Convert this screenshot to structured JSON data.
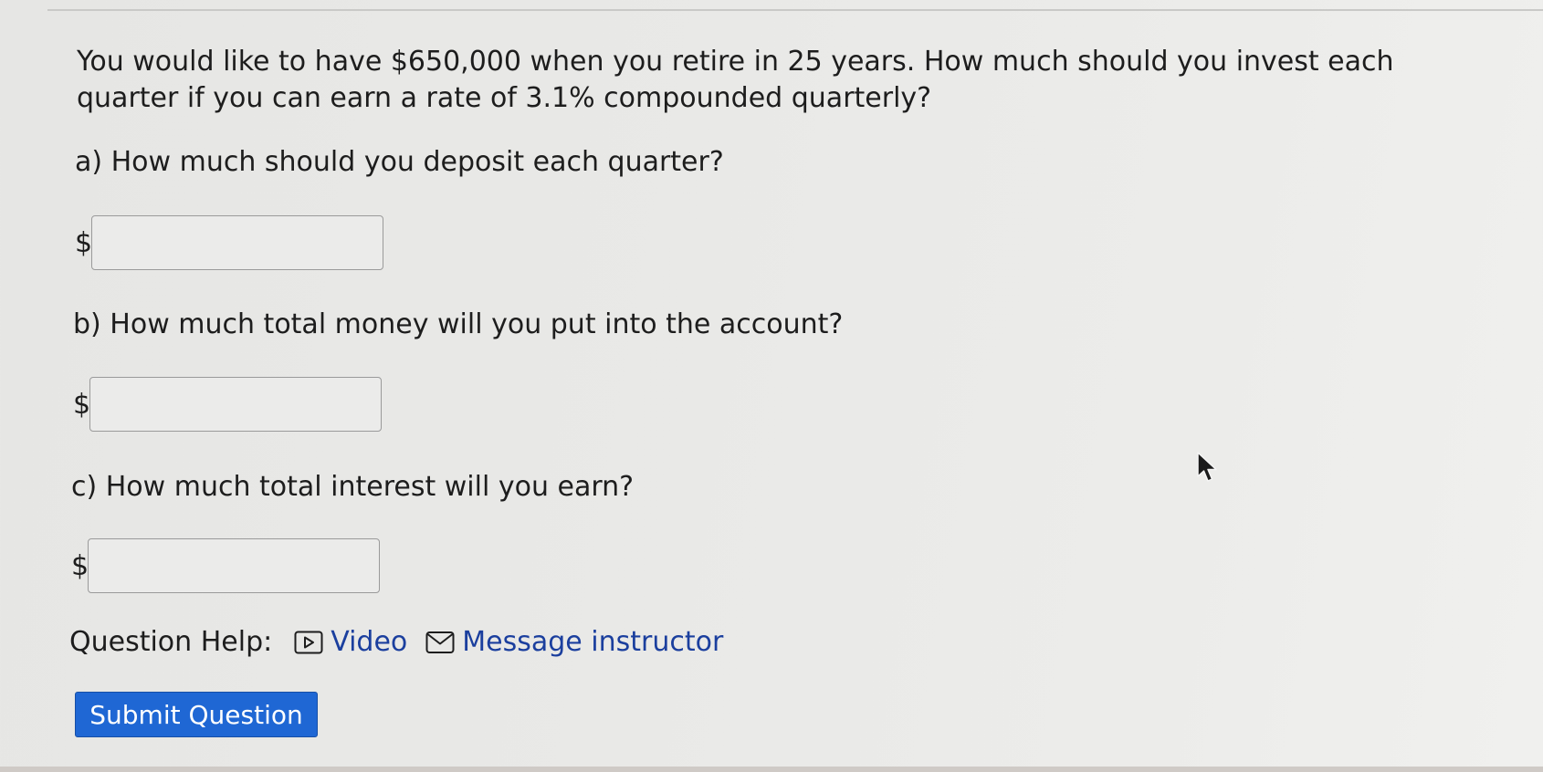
{
  "question": {
    "text": "You would like to have $650,000 when you retire in 25 years. How much should you invest each quarter if you can earn a rate of 3.1% compounded quarterly?"
  },
  "parts": [
    {
      "label": "a) How much should you deposit each quarter?",
      "currency_symbol": "$",
      "value": "",
      "placeholder": ""
    },
    {
      "label": "b) How much total money will you put into the account?",
      "currency_symbol": "$",
      "value": "",
      "placeholder": ""
    },
    {
      "label": "c) How much total interest will you earn?",
      "currency_symbol": "$",
      "value": "",
      "placeholder": ""
    }
  ],
  "help": {
    "label": "Question Help:",
    "video_label": "Video",
    "video_icon": "video-icon",
    "message_label": "Message instructor",
    "message_icon": "envelope-icon"
  },
  "submit": {
    "label": "Submit Question"
  },
  "colors": {
    "link": "#1b3f9e",
    "button_bg": "#1f67d4",
    "button_text": "#ffffff"
  }
}
